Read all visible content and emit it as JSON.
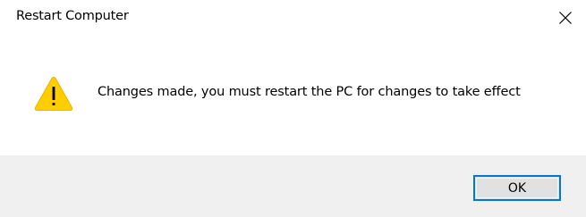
{
  "window": {
    "title": "Restart Computer",
    "close_icon": "close-icon"
  },
  "message": {
    "icon": "warning-icon",
    "text": "Changes made, you must restart the PC for changes to take effect"
  },
  "footer": {
    "ok_label": "OK"
  },
  "colors": {
    "warning_fill": "#ffcd00",
    "footer_bg": "#f0f0f0",
    "button_border": "#0078d7",
    "button_bg": "#e1e1e1"
  }
}
